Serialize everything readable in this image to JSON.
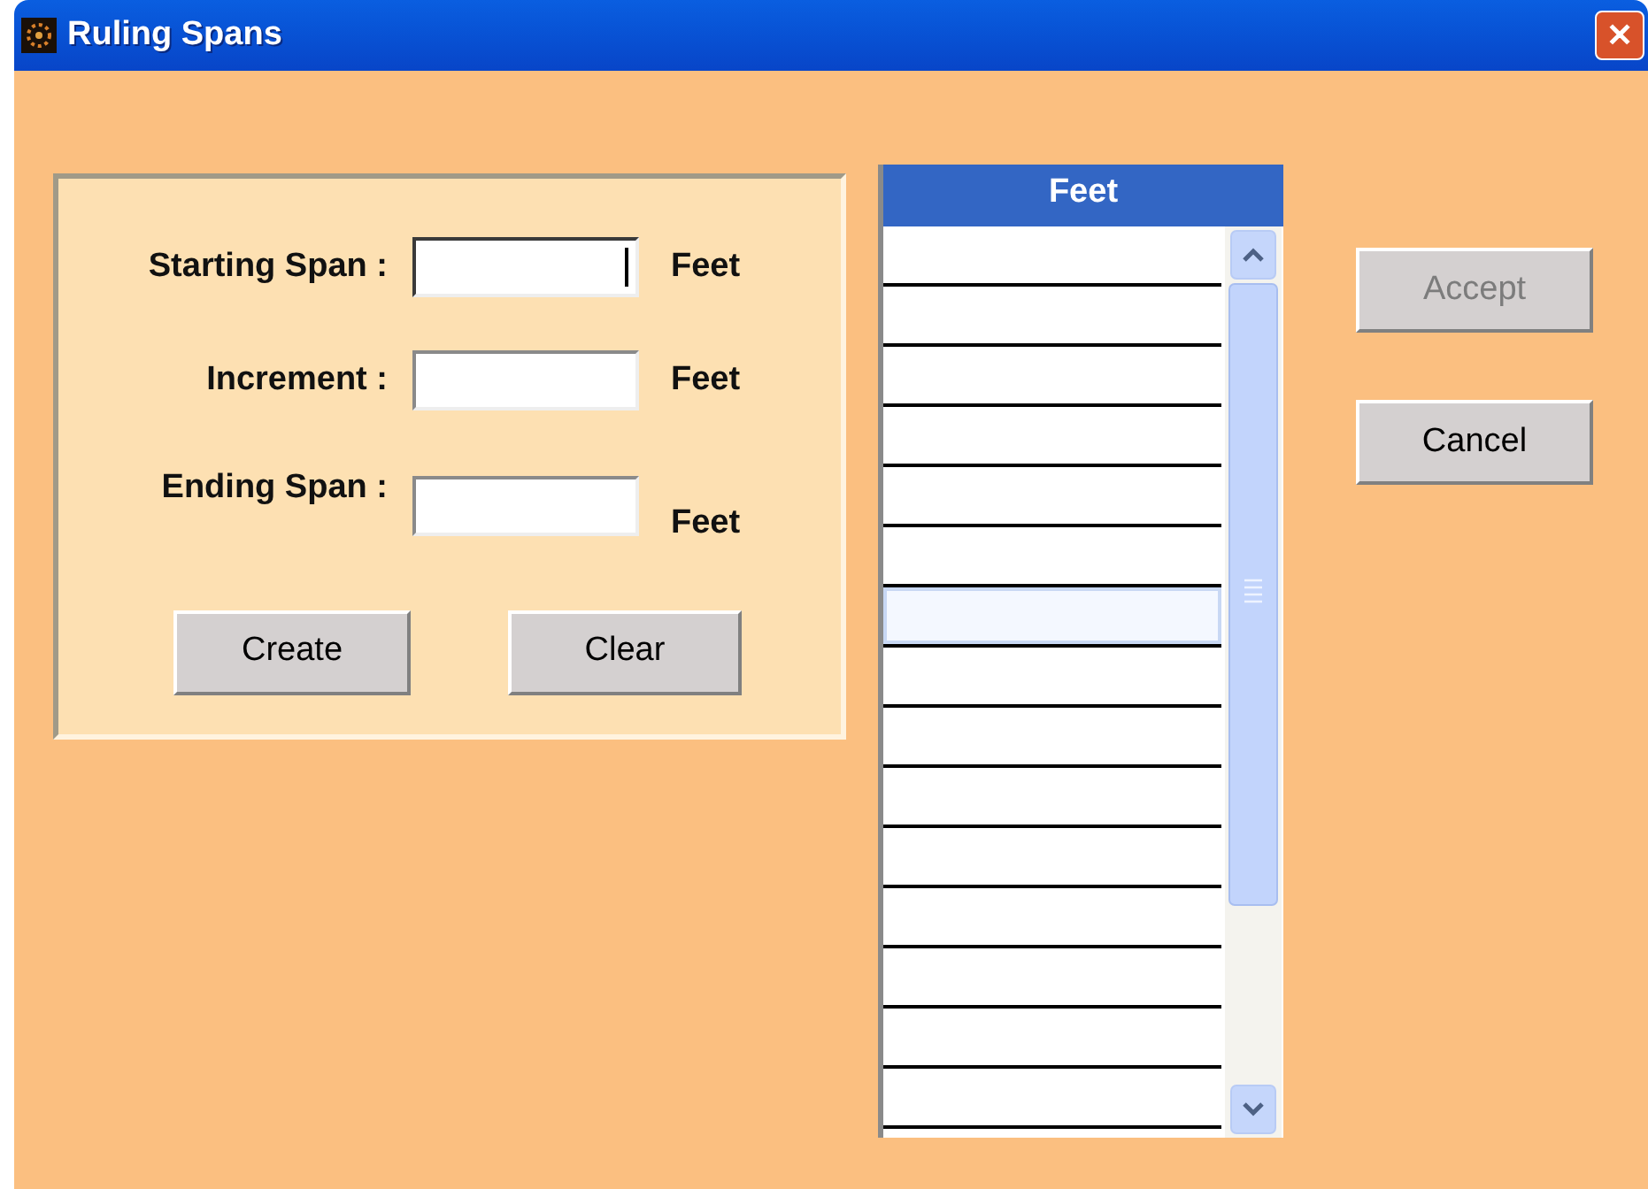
{
  "window": {
    "title": "Ruling Spans",
    "close": "✕"
  },
  "form": {
    "fields": [
      {
        "label": "Starting Span :",
        "unit": "Feet",
        "focused": true
      },
      {
        "label": "Increment :",
        "unit": "Feet",
        "focused": false
      },
      {
        "label": "Ending Span :",
        "unit": "Feet",
        "focused": false
      }
    ],
    "buttons": [
      {
        "label": "Create",
        "disabled": false
      },
      {
        "label": "Clear",
        "disabled": false
      }
    ]
  },
  "grid": {
    "header": "Feet",
    "rows": [
      {
        "selected": false
      },
      {
        "selected": false
      },
      {
        "selected": false
      },
      {
        "selected": false
      },
      {
        "selected": false
      },
      {
        "selected": false
      },
      {
        "selected": true
      },
      {
        "selected": false
      },
      {
        "selected": false
      },
      {
        "selected": false
      },
      {
        "selected": false
      },
      {
        "selected": false
      },
      {
        "selected": false
      },
      {
        "selected": false
      },
      {
        "selected": false
      }
    ]
  },
  "actions": [
    {
      "label": "Accept",
      "disabled": true
    },
    {
      "label": "Cancel",
      "disabled": false
    }
  ]
}
